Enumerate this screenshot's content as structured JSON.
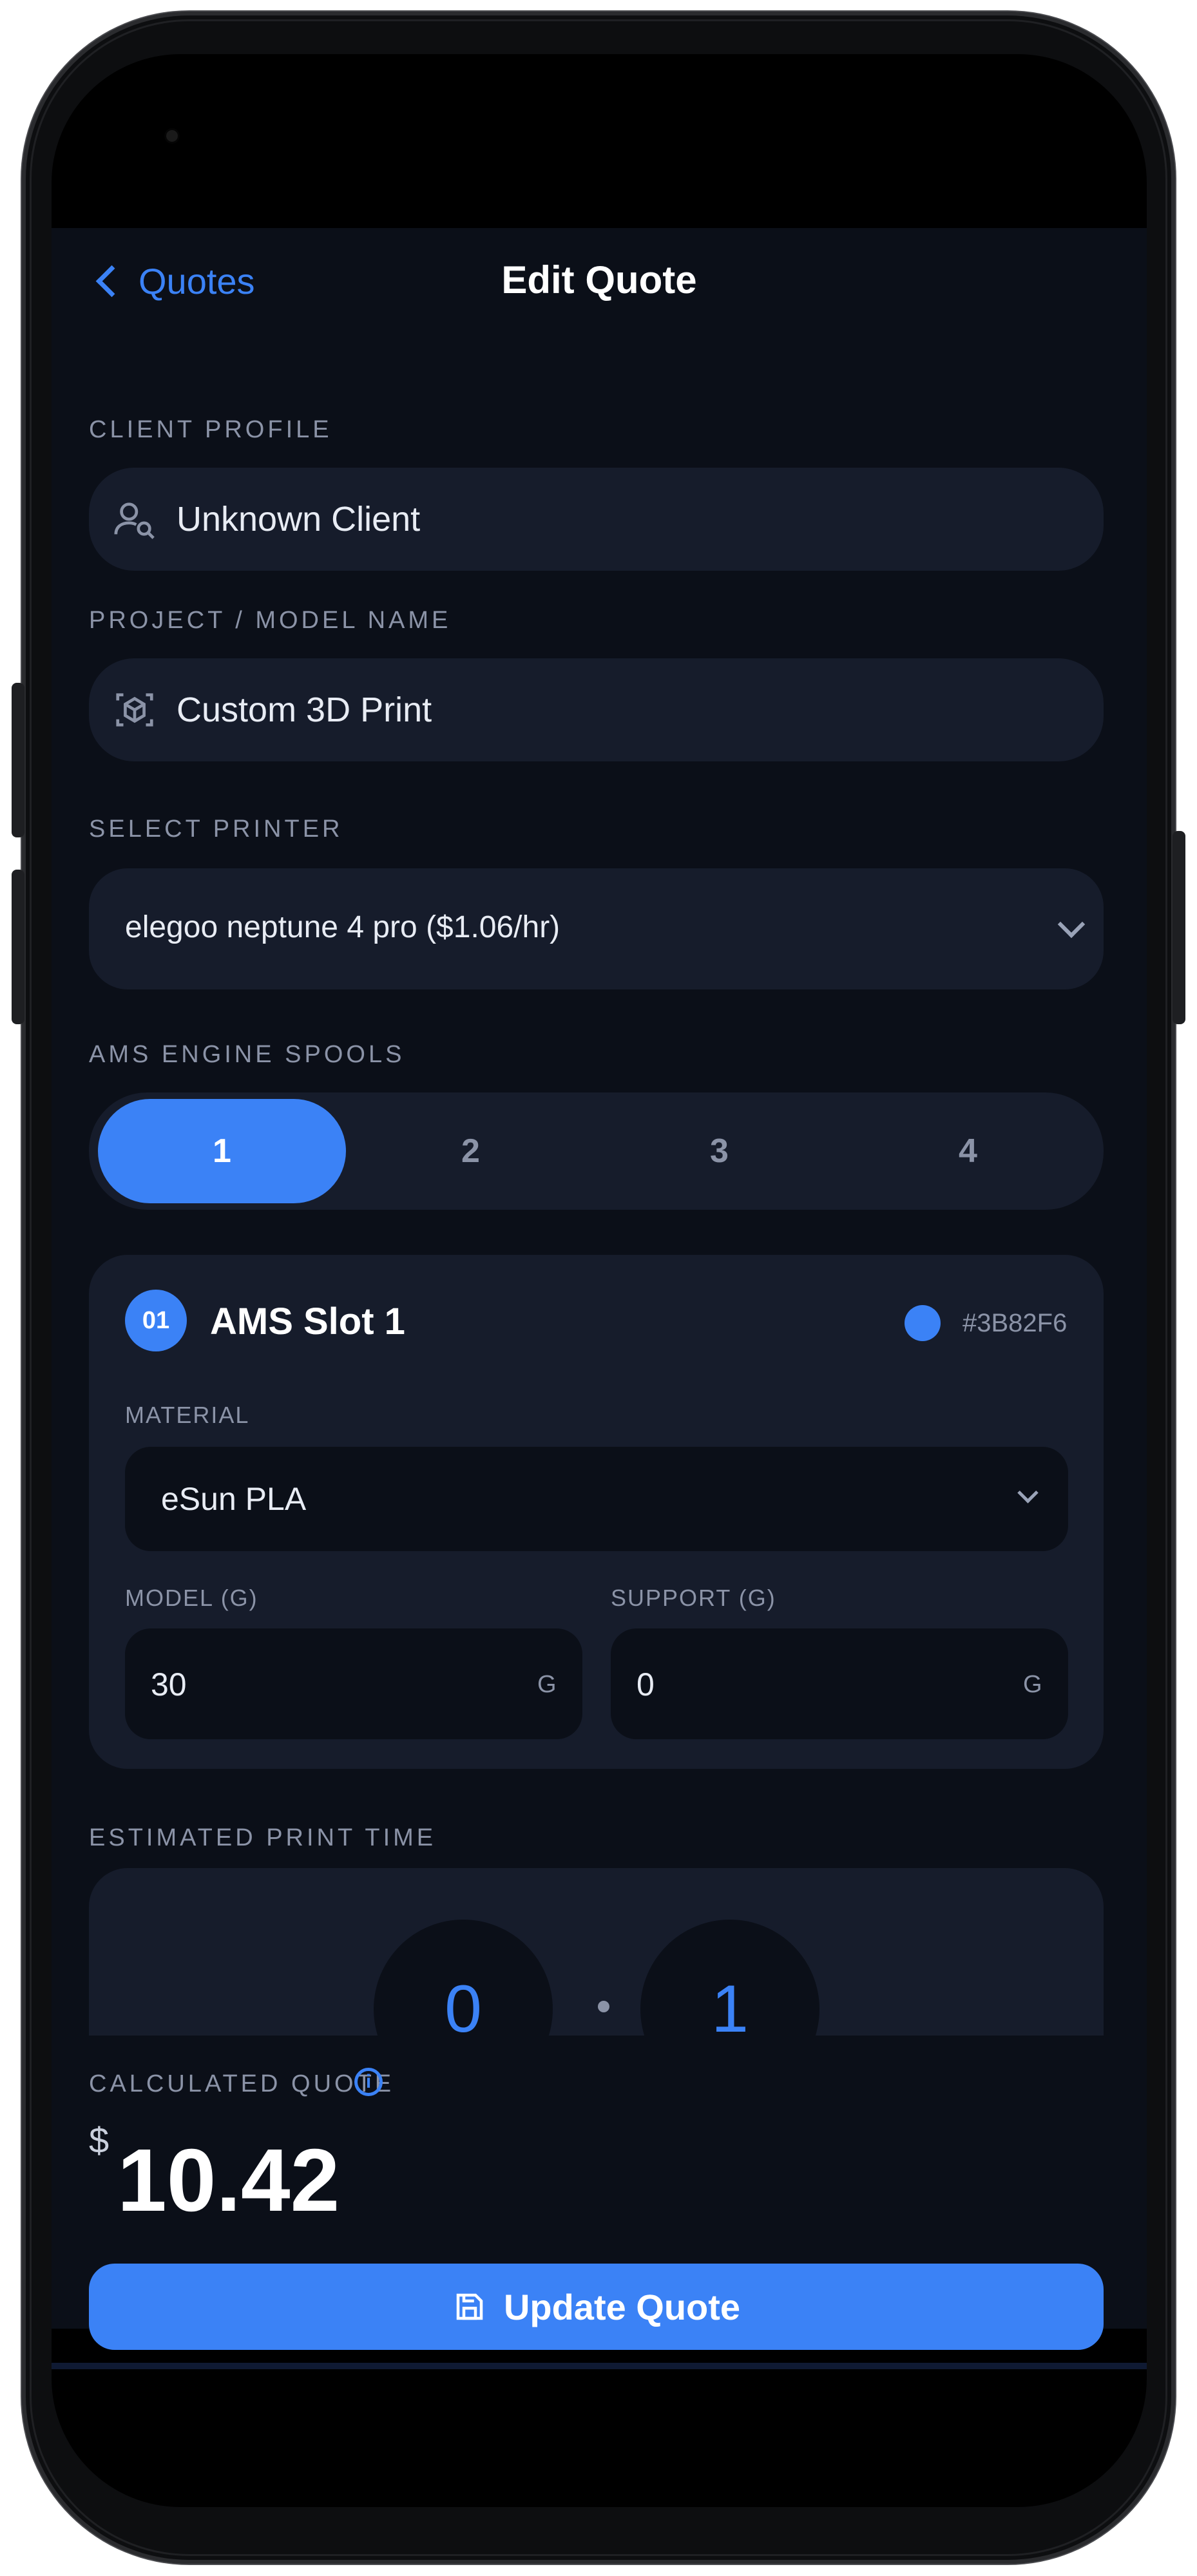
{
  "header": {
    "back_label": "Quotes",
    "title": "Edit Quote"
  },
  "client": {
    "label": "CLIENT PROFILE",
    "value": "Unknown Client",
    "icon": "user-search-icon"
  },
  "project": {
    "label": "PROJECT / MODEL NAME",
    "value": "Custom 3D Print",
    "icon": "cube-scan-icon"
  },
  "printer": {
    "label": "SELECT PRINTER",
    "value": "elegoo neptune 4 pro ($1.06/hr)"
  },
  "spools": {
    "label": "AMS ENGINE SPOOLS",
    "items": [
      "1",
      "2",
      "3",
      "4"
    ],
    "selected": "1"
  },
  "slot": {
    "badge": "01",
    "title": "AMS Slot 1",
    "color_hex": "#3B82F6",
    "material_label": "MATERIAL",
    "material_value": "eSun PLA",
    "model_label": "MODEL (G)",
    "model_value": "30",
    "support_label": "SUPPORT (G)",
    "support_value": "0",
    "unit": "G"
  },
  "print_time": {
    "label": "ESTIMATED PRINT TIME",
    "hours": "0",
    "minutes": "1"
  },
  "quote": {
    "label": "CALCULATED QUOTE",
    "currency": "$",
    "amount": "10.42"
  },
  "actions": {
    "update_label": "Update Quote"
  },
  "colors": {
    "accent": "#3B82F6",
    "background": "#0B0F18",
    "surface": "#161C2B"
  }
}
